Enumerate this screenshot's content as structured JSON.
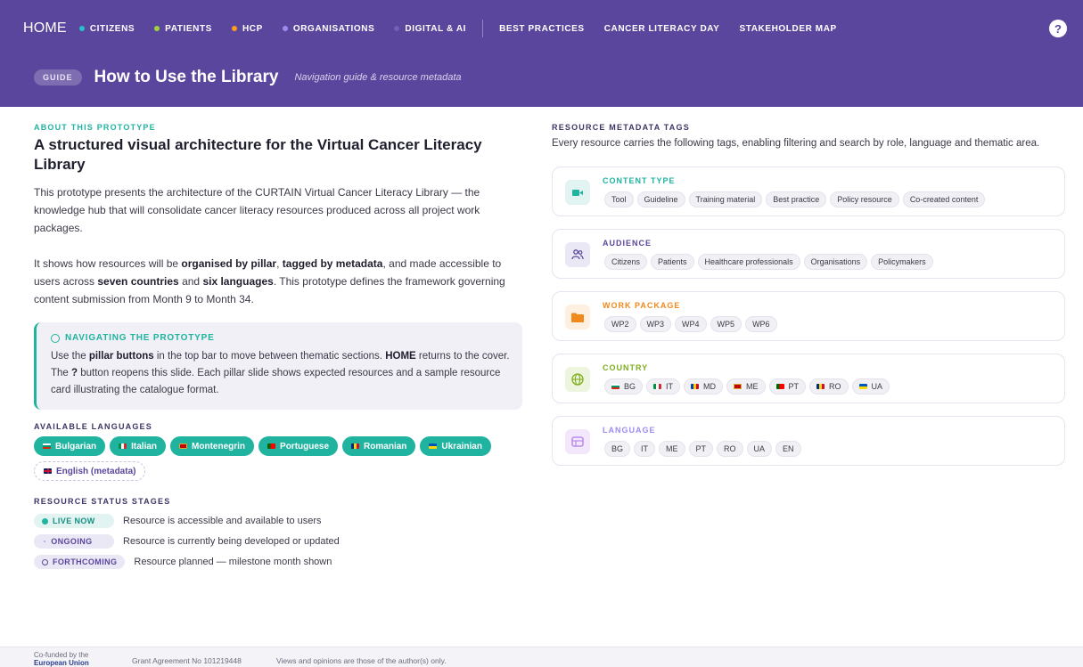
{
  "nav": {
    "home": "HOME",
    "items": [
      {
        "label": "CITIZENS",
        "color": "#27c1c9"
      },
      {
        "label": "PATIENTS",
        "color": "#a5d23a"
      },
      {
        "label": "HCP",
        "color": "#ff9a1f"
      },
      {
        "label": "ORGANISATIONS",
        "color": "#9b8df0"
      },
      {
        "label": "DIGITAL & AI",
        "color": "#7060b8"
      }
    ],
    "extra": [
      "BEST PRACTICES",
      "CANCER LITERACY DAY",
      "STAKEHOLDER MAP"
    ],
    "help": "?"
  },
  "header": {
    "badge": "GUIDE",
    "title": "How to Use the Library",
    "subtitle": "Navigation guide & resource metadata"
  },
  "about": {
    "eyebrow": "ABOUT THIS PROTOTYPE",
    "headline": "A structured visual architecture for the Virtual Cancer Literacy Library",
    "p1": "This prototype presents the architecture of the CURTAIN Virtual Cancer Literacy Library — the knowledge hub that will consolidate cancer literacy resources produced across all project work packages.",
    "p2_a": "It shows how resources will be ",
    "p2_b": "organised by pillar",
    "p2_c": ", ",
    "p2_d": "tagged by metadata",
    "p2_e": ", and made accessible to users across ",
    "p2_f": "seven countries",
    "p2_g": " and ",
    "p2_h": "six languages",
    "p2_i": ". This prototype defines the framework governing content submission from Month 9 to Month 34."
  },
  "callout": {
    "title": "NAVIGATING THE PROTOTYPE",
    "t1": "Use the ",
    "t2": "pillar buttons",
    "t3": " in the top bar to move between thematic sections. ",
    "t4": "HOME",
    "t5": " returns to the cover. The ",
    "t6": "?",
    "t7": " button reopens this slide. Each pillar slide shows expected resources and a sample resource card illustrating the catalogue format."
  },
  "languages": {
    "title": "AVAILABLE LANGUAGES",
    "items": [
      "Bulgarian",
      "Italian",
      "Montenegrin",
      "Portuguese",
      "Romanian",
      "Ukrainian"
    ],
    "metadata": "English (metadata)"
  },
  "status": {
    "title": "RESOURCE STATUS STAGES",
    "items": [
      {
        "label": "LIVE NOW",
        "desc": "Resource is accessible and available to users"
      },
      {
        "label": "ONGOING",
        "desc": "Resource is currently being developed or updated"
      },
      {
        "label": "FORTHCOMING",
        "desc": "Resource planned — milestone month shown"
      }
    ]
  },
  "metadata": {
    "eyebrow": "RESOURCE METADATA TAGS",
    "desc": "Every resource carries the following tags, enabling filtering and search by role, language and thematic area.",
    "cards": [
      {
        "title": "CONTENT TYPE",
        "color": "#1fb3a0",
        "icon": "video-icon",
        "tags": [
          "Tool",
          "Guideline",
          "Training material",
          "Best practice",
          "Policy resource",
          "Co-created content"
        ]
      },
      {
        "title": "AUDIENCE",
        "color": "#5a469c",
        "icon": "people-icon",
        "tags": [
          "Citizens",
          "Patients",
          "Healthcare professionals",
          "Organisations",
          "Policymakers"
        ]
      },
      {
        "title": "WORK PACKAGE",
        "color": "#f08a1c",
        "icon": "folder-icon",
        "tags": [
          "WP2",
          "WP3",
          "WP4",
          "WP5",
          "WP6"
        ]
      },
      {
        "title": "COUNTRY",
        "color": "#7fae1f",
        "icon": "globe-icon",
        "tags": [
          "BG",
          "IT",
          "MD",
          "ME",
          "PT",
          "RO",
          "UA"
        ]
      },
      {
        "title": "LANGUAGE",
        "color": "#9b8df0",
        "icon": "language-icon",
        "tags": [
          "BG",
          "IT",
          "ME",
          "PT",
          "RO",
          "UA",
          "EN"
        ]
      }
    ]
  },
  "footer": {
    "cofunded": "Co-funded by the",
    "eu": "European Union",
    "grant": "Grant Agreement No 101219448",
    "disclaimer": "Views and opinions are those of the author(s) only."
  }
}
